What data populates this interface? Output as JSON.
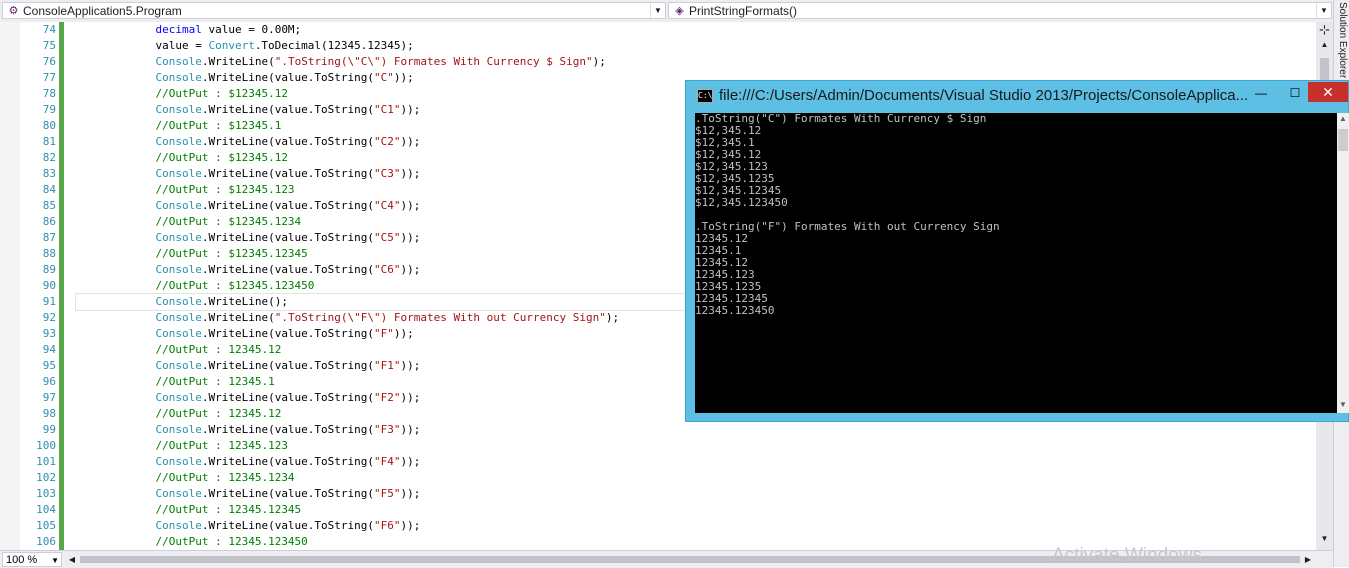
{
  "navbar": {
    "project_combo": {
      "icon": "csharp-project-icon",
      "text": "ConsoleApplication5.Program"
    },
    "member_combo": {
      "icon": "method-icon",
      "text": "PrintStringFormats()"
    }
  },
  "sidepanel": {
    "label": "Solution Explorer"
  },
  "editor": {
    "line_numbers": [
      "74",
      "75",
      "76",
      "77",
      "78",
      "79",
      "80",
      "81",
      "82",
      "83",
      "84",
      "85",
      "86",
      "87",
      "88",
      "89",
      "90",
      "91",
      "92",
      "93",
      "94",
      "95",
      "96",
      "97",
      "98",
      "99",
      "100",
      "101",
      "102",
      "103",
      "104",
      "105",
      "106"
    ],
    "current_line_index": 17,
    "code_lines": [
      [
        {
          "t": "            "
        },
        {
          "c": "kw",
          "t": "decimal"
        },
        {
          "t": " value = 0.00M;"
        }
      ],
      [
        {
          "t": "            value = "
        },
        {
          "c": "ty",
          "t": "Convert"
        },
        {
          "t": ".ToDecimal(12345.12345);"
        }
      ],
      [
        {
          "t": "            "
        },
        {
          "c": "ty",
          "t": "Console"
        },
        {
          "t": ".WriteLine("
        },
        {
          "c": "st",
          "t": "\".ToString(\\\"C\\\") Formates With Currency $ Sign\""
        },
        {
          "t": ");"
        }
      ],
      [
        {
          "t": "            "
        },
        {
          "c": "ty",
          "t": "Console"
        },
        {
          "t": ".WriteLine(value.ToString("
        },
        {
          "c": "st",
          "t": "\"C\""
        },
        {
          "t": "));"
        }
      ],
      [
        {
          "t": "            "
        },
        {
          "c": "cm",
          "t": "//OutPut : $12345.12"
        }
      ],
      [
        {
          "t": "            "
        },
        {
          "c": "ty",
          "t": "Console"
        },
        {
          "t": ".WriteLine(value.ToString("
        },
        {
          "c": "st",
          "t": "\"C1\""
        },
        {
          "t": "));"
        }
      ],
      [
        {
          "t": "            "
        },
        {
          "c": "cm",
          "t": "//OutPut : $12345.1"
        }
      ],
      [
        {
          "t": "            "
        },
        {
          "c": "ty",
          "t": "Console"
        },
        {
          "t": ".WriteLine(value.ToString("
        },
        {
          "c": "st",
          "t": "\"C2\""
        },
        {
          "t": "));"
        }
      ],
      [
        {
          "t": "            "
        },
        {
          "c": "cm",
          "t": "//OutPut : $12345.12"
        }
      ],
      [
        {
          "t": "            "
        },
        {
          "c": "ty",
          "t": "Console"
        },
        {
          "t": ".WriteLine(value.ToString("
        },
        {
          "c": "st",
          "t": "\"C3\""
        },
        {
          "t": "));"
        }
      ],
      [
        {
          "t": "            "
        },
        {
          "c": "cm",
          "t": "//OutPut : $12345.123"
        }
      ],
      [
        {
          "t": "            "
        },
        {
          "c": "ty",
          "t": "Console"
        },
        {
          "t": ".WriteLine(value.ToString("
        },
        {
          "c": "st",
          "t": "\"C4\""
        },
        {
          "t": "));"
        }
      ],
      [
        {
          "t": "            "
        },
        {
          "c": "cm",
          "t": "//OutPut : $12345.1234"
        }
      ],
      [
        {
          "t": "            "
        },
        {
          "c": "ty",
          "t": "Console"
        },
        {
          "t": ".WriteLine(value.ToString("
        },
        {
          "c": "st",
          "t": "\"C5\""
        },
        {
          "t": "));"
        }
      ],
      [
        {
          "t": "            "
        },
        {
          "c": "cm",
          "t": "//OutPut : $12345.12345"
        }
      ],
      [
        {
          "t": "            "
        },
        {
          "c": "ty",
          "t": "Console"
        },
        {
          "t": ".WriteLine(value.ToString("
        },
        {
          "c": "st",
          "t": "\"C6\""
        },
        {
          "t": "));"
        }
      ],
      [
        {
          "t": "            "
        },
        {
          "c": "cm",
          "t": "//OutPut : $12345.123450"
        }
      ],
      [
        {
          "t": "            "
        },
        {
          "c": "ty",
          "t": "Console"
        },
        {
          "t": ".WriteLine();"
        }
      ],
      [
        {
          "t": "            "
        },
        {
          "c": "ty",
          "t": "Console"
        },
        {
          "t": ".WriteLine("
        },
        {
          "c": "st",
          "t": "\".ToString(\\\"F\\\") Formates With out Currency Sign\""
        },
        {
          "t": ");"
        }
      ],
      [
        {
          "t": "            "
        },
        {
          "c": "ty",
          "t": "Console"
        },
        {
          "t": ".WriteLine(value.ToString("
        },
        {
          "c": "st",
          "t": "\"F\""
        },
        {
          "t": "));"
        }
      ],
      [
        {
          "t": "            "
        },
        {
          "c": "cm",
          "t": "//OutPut : 12345.12"
        }
      ],
      [
        {
          "t": "            "
        },
        {
          "c": "ty",
          "t": "Console"
        },
        {
          "t": ".WriteLine(value.ToString("
        },
        {
          "c": "st",
          "t": "\"F1\""
        },
        {
          "t": "));"
        }
      ],
      [
        {
          "t": "            "
        },
        {
          "c": "cm",
          "t": "//OutPut : 12345.1"
        }
      ],
      [
        {
          "t": "            "
        },
        {
          "c": "ty",
          "t": "Console"
        },
        {
          "t": ".WriteLine(value.ToString("
        },
        {
          "c": "st",
          "t": "\"F2\""
        },
        {
          "t": "));"
        }
      ],
      [
        {
          "t": "            "
        },
        {
          "c": "cm",
          "t": "//OutPut : 12345.12"
        }
      ],
      [
        {
          "t": "            "
        },
        {
          "c": "ty",
          "t": "Console"
        },
        {
          "t": ".WriteLine(value.ToString("
        },
        {
          "c": "st",
          "t": "\"F3\""
        },
        {
          "t": "));"
        }
      ],
      [
        {
          "t": "            "
        },
        {
          "c": "cm",
          "t": "//OutPut : 12345.123"
        }
      ],
      [
        {
          "t": "            "
        },
        {
          "c": "ty",
          "t": "Console"
        },
        {
          "t": ".WriteLine(value.ToString("
        },
        {
          "c": "st",
          "t": "\"F4\""
        },
        {
          "t": "));"
        }
      ],
      [
        {
          "t": "            "
        },
        {
          "c": "cm",
          "t": "//OutPut : 12345.1234"
        }
      ],
      [
        {
          "t": "            "
        },
        {
          "c": "ty",
          "t": "Console"
        },
        {
          "t": ".WriteLine(value.ToString("
        },
        {
          "c": "st",
          "t": "\"F5\""
        },
        {
          "t": "));"
        }
      ],
      [
        {
          "t": "            "
        },
        {
          "c": "cm",
          "t": "//OutPut : 12345.12345"
        }
      ],
      [
        {
          "t": "            "
        },
        {
          "c": "ty",
          "t": "Console"
        },
        {
          "t": ".WriteLine(value.ToString("
        },
        {
          "c": "st",
          "t": "\"F6\""
        },
        {
          "t": "));"
        }
      ],
      [
        {
          "t": "            "
        },
        {
          "c": "cm",
          "t": "//OutPut : 12345.123450"
        }
      ]
    ]
  },
  "statusbar": {
    "zoom": "100 %"
  },
  "watermark": "Activate Windows",
  "console": {
    "title": "file:///C:/Users/Admin/Documents/Visual Studio 2013/Projects/ConsoleApplica...",
    "icon_glyph": "C:\\",
    "min_glyph": "—",
    "max_glyph": "☐",
    "close_glyph": "✕",
    "output": [
      ".ToString(\"C\") Formates With Currency $ Sign",
      "$12,345.12",
      "$12,345.1",
      "$12,345.12",
      "$12,345.123",
      "$12,345.1235",
      "$12,345.12345",
      "$12,345.123450",
      "",
      ".ToString(\"F\") Formates With out Currency Sign",
      "12345.12",
      "12345.1",
      "12345.12",
      "12345.123",
      "12345.1235",
      "12345.12345",
      "12345.123450"
    ]
  },
  "colors": {
    "keyword": "#0000ff",
    "type": "#2b91af",
    "string": "#a31515",
    "comment": "#008000",
    "line_number": "#2b91af",
    "change_bar": "#57a64a",
    "console_frame": "#5cbfe3",
    "close_button": "#c9302c"
  }
}
